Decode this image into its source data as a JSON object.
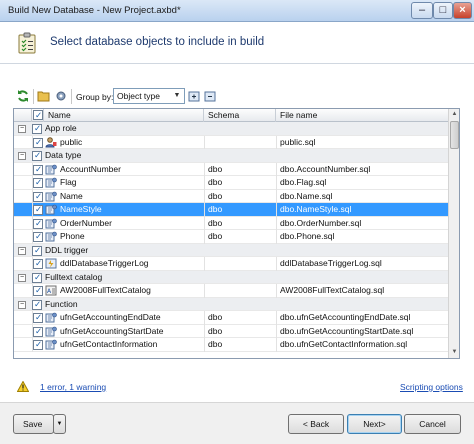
{
  "window": {
    "title": "Build New Database - New Project.axbd*"
  },
  "header": {
    "text": "Select database objects to include in build"
  },
  "toolbar": {
    "group_by_label": "Group by:",
    "group_by_value": "Object type"
  },
  "grid": {
    "columns": [
      "Name",
      "Schema",
      "File name"
    ],
    "rows": [
      {
        "kind": "group",
        "name": "App role"
      },
      {
        "kind": "item",
        "name": "public",
        "schema": "",
        "file": "public.sql"
      },
      {
        "kind": "group",
        "name": "Data type"
      },
      {
        "kind": "item",
        "name": "AccountNumber",
        "schema": "dbo",
        "file": "dbo.AccountNumber.sql"
      },
      {
        "kind": "item",
        "name": "Flag",
        "schema": "dbo",
        "file": "dbo.Flag.sql"
      },
      {
        "kind": "item",
        "name": "Name",
        "schema": "dbo",
        "file": "dbo.Name.sql"
      },
      {
        "kind": "item",
        "name": "NameStyle",
        "schema": "dbo",
        "file": "dbo.NameStyle.sql",
        "selected": true
      },
      {
        "kind": "item",
        "name": "OrderNumber",
        "schema": "dbo",
        "file": "dbo.OrderNumber.sql"
      },
      {
        "kind": "item",
        "name": "Phone",
        "schema": "dbo",
        "file": "dbo.Phone.sql"
      },
      {
        "kind": "group",
        "name": "DDL trigger"
      },
      {
        "kind": "item",
        "name": "ddlDatabaseTriggerLog",
        "schema": "",
        "file": "ddlDatabaseTriggerLog.sql"
      },
      {
        "kind": "group",
        "name": "Fulltext catalog"
      },
      {
        "kind": "item",
        "name": "AW2008FullTextCatalog",
        "schema": "",
        "file": "AW2008FullTextCatalog.sql"
      },
      {
        "kind": "group",
        "name": "Function"
      },
      {
        "kind": "item",
        "name": "ufnGetAccountingEndDate",
        "schema": "dbo",
        "file": "dbo.ufnGetAccountingEndDate.sql"
      },
      {
        "kind": "item",
        "name": "ufnGetAccountingStartDate",
        "schema": "dbo",
        "file": "dbo.ufnGetAccountingStartDate.sql"
      },
      {
        "kind": "item",
        "name": "ufnGetContactInformation",
        "schema": "dbo",
        "file": "dbo.ufnGetContactInformation.sql"
      }
    ]
  },
  "status": {
    "errors_link": "1 error, 1 warning",
    "scripting_link": "Scripting options"
  },
  "footer": {
    "save": "Save",
    "back": "< Back",
    "next": "Next>",
    "cancel": "Cancel"
  },
  "colors": {
    "selection": "#3399ff",
    "link": "#1a4cb3",
    "header_text": "#1e3a6e"
  }
}
